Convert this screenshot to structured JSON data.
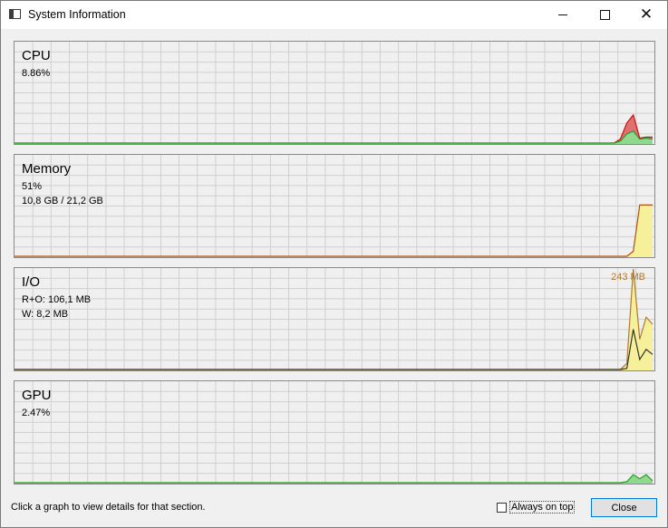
{
  "window": {
    "title": "System Information",
    "controls": {
      "minimize_icon": "minimize-icon",
      "maximize_icon": "maximize-icon",
      "close_icon": "close-icon"
    }
  },
  "colors": {
    "grid_line": "#d0d0d0",
    "panel_bg": "#f0f0f0",
    "cpu_user_fill": "#e07070",
    "cpu_user_line": "#cc1010",
    "cpu_kernel_fill": "#90d890",
    "cpu_kernel_line": "#22a022",
    "memory_fill": "#f6f09a",
    "memory_line": "#b05010",
    "io_fill": "#f6f09a",
    "io_read_line": "#b07a30",
    "io_write_line": "#333333",
    "gpu_line": "#22a022",
    "accent": "#0078d7"
  },
  "panels": {
    "cpu": {
      "title": "CPU",
      "line1": "8.86%"
    },
    "memory": {
      "title": "Memory",
      "line1": "51%",
      "line2": "10,8 GB / 21,2 GB"
    },
    "io": {
      "title": "I/O",
      "line1": "R+O: 106,1 MB",
      "line2": "W: 8,2 MB",
      "peak_label": "243 MB"
    },
    "gpu": {
      "title": "GPU",
      "line1": "2.47%"
    }
  },
  "history": {
    "samples": 100,
    "cpu_user_tail": [
      4,
      20,
      28,
      5,
      6,
      6
    ],
    "cpu_kernel_tail": [
      2,
      9,
      12,
      4,
      5,
      4
    ],
    "memory_tail": [
      5,
      51,
      51,
      51
    ],
    "io_tail": [
      6,
      100,
      30,
      52,
      45
    ],
    "io_write_tail": [
      1,
      40,
      10,
      20,
      15
    ],
    "gpu_tail": [
      1,
      8,
      4,
      8,
      2
    ]
  },
  "footer": {
    "hint": "Click a graph to view details for that section.",
    "always_on_top_label": "Always on top",
    "always_on_top_checked": false,
    "close_label": "Close"
  }
}
